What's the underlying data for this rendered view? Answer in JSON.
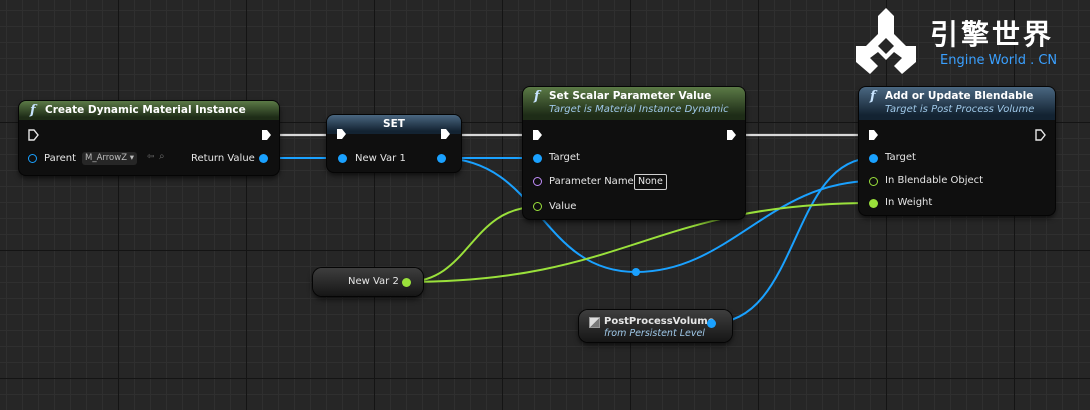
{
  "logo": {
    "title": "引擎世界",
    "subtitle": "Engine World . CN"
  },
  "nodes": {
    "create_material": {
      "title": "Create Dynamic Material Instance",
      "parent_label": "Parent",
      "parent_value": "M_ArrowZ",
      "return_label": "Return Value"
    },
    "set": {
      "title": "SET",
      "var_label": "New Var 1"
    },
    "set_scalar": {
      "title": "Set Scalar Parameter Value",
      "subtitle": "Target is Material Instance Dynamic",
      "target_label": "Target",
      "param_name_label": "Parameter Name",
      "param_name_value": "None",
      "value_label": "Value"
    },
    "add_blendable": {
      "title": "Add or Update Blendable",
      "subtitle": "Target is Post Process Volume",
      "target_label": "Target",
      "blendable_label": "In Blendable Object",
      "weight_label": "In Weight"
    },
    "new_var2": {
      "label": "New Var 2"
    },
    "post_process": {
      "label": "PostProcessVolume",
      "sublabel": "from Persistent Level"
    }
  },
  "colors": {
    "exec_wire": "#d9d9d9",
    "object_wire": "#1aa1ff",
    "float_wire": "#9ae13b",
    "name_pin": "#c18dfb",
    "logo_accent": "#3aa0ff"
  }
}
